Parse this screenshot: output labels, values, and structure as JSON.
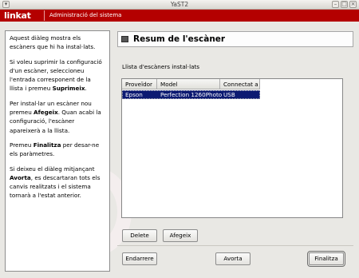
{
  "window": {
    "title": "YaST2"
  },
  "banner": {
    "logo": "linkat",
    "title": "Administració del sistema"
  },
  "help": {
    "p1": "Aquest diàleg mostra els escàners que hi ha instal·lats.",
    "p2_pre": "Si voleu suprimir la configuració d'un escàner, seleccioneu l'entrada corresponent de la llista i premeu ",
    "p2_bold": "Suprimeix",
    "p2_post": ".",
    "p3_pre": "Per instal·lar un escàner nou premeu ",
    "p3_bold": "Afegeix",
    "p3_post": ". Quan acabi la configuració, l'escàner apareixerà a la llista.",
    "p4_pre": "Premeu ",
    "p4_bold": "Finalitza",
    "p4_post": " per desar-ne els paràmetres.",
    "p5_pre": "Si deixeu el diàleg mitjançant ",
    "p5_bold": "Avorta",
    "p5_post": ", es descartaran tots els canvis realitzats i el sistema tornarà a l'estat anterior."
  },
  "main": {
    "title": "Resum de l'escàner",
    "list_label": "Llista d'escàners instal·lats"
  },
  "table": {
    "columns": [
      "Proveïdor",
      "Model",
      "Connectat a"
    ],
    "rows": [
      [
        "Epson",
        "Perfection 1260Photo",
        "USB"
      ]
    ]
  },
  "buttons": {
    "delete": "Delete",
    "add": "Afegeix",
    "back": "Endarrere",
    "abort": "Avorta",
    "finish": "Finalitza"
  }
}
